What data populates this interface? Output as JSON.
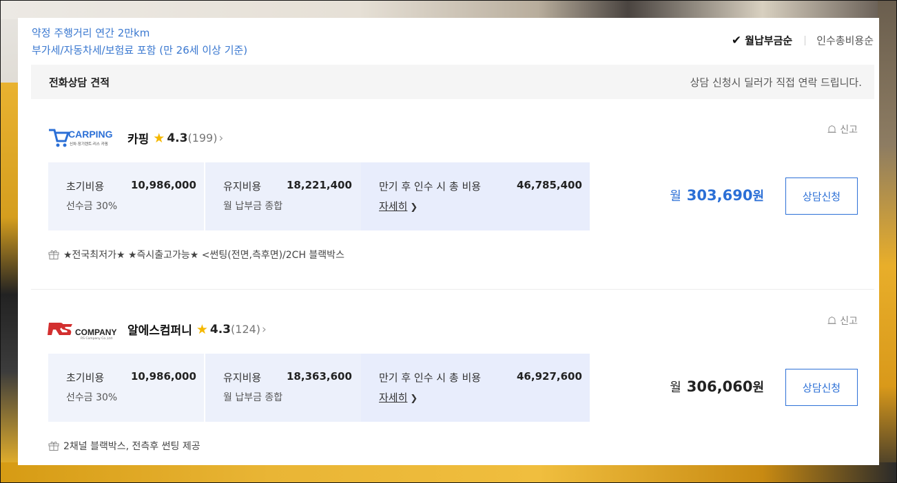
{
  "conditions": {
    "line1": "약정 주행거리 연간 2만km",
    "line2": "부가세/자동차세/보험료 포함 (만 26세 이상 기준)"
  },
  "sort": {
    "active_label": "월납부금순",
    "other_label": "인수총비용순"
  },
  "phone_section": {
    "title": "전화상담 견적",
    "note": "상담 신청시 딜러가 직접 연락 드립니다."
  },
  "offers": [
    {
      "logo_text": "CARPING",
      "logo_subtext": "신차·장기렌트·리스 카핑",
      "dealer_name": "카핑",
      "rating": "4.3",
      "review_count": "(199)",
      "report_label": "신고",
      "initial_cost_label": "초기비용",
      "initial_cost_value": "10,986,000",
      "initial_cost_sub": "선수금 30%",
      "maintenance_label": "유지비용",
      "maintenance_value": "18,221,400",
      "maintenance_sub": "월 납부금 종합",
      "total_label": "만기 후 인수 시 총 비용",
      "total_value": "46,785,400",
      "detail_link": "자세히",
      "monthly_prefix": "월",
      "monthly_amount": "303,690",
      "monthly_unit": "원",
      "monthly_color": "#2b6fd6",
      "button_label": "상담신청",
      "benefit": "★전국최저가★ ★즉시출고가능★ <썬팅(전면,측후면)/2CH 블랙박스"
    },
    {
      "logo_text": "COMPANY",
      "logo_subtext": "RS Company Co.,Ltd",
      "dealer_name": "알에스컴퍼니",
      "rating": "4.3",
      "review_count": "(124)",
      "report_label": "신고",
      "initial_cost_label": "초기비용",
      "initial_cost_value": "10,986,000",
      "initial_cost_sub": "선수금 30%",
      "maintenance_label": "유지비용",
      "maintenance_value": "18,363,600",
      "maintenance_sub": "월 납부금 종합",
      "total_label": "만기 후 인수 시 총 비용",
      "total_value": "46,927,600",
      "detail_link": "자세히",
      "monthly_prefix": "월",
      "monthly_amount": "306,060",
      "monthly_unit": "원",
      "monthly_color": "#222222",
      "button_label": "상담신청",
      "benefit": "2채널 블랙박스, 전측후 썬팅 제공"
    }
  ],
  "icons": {
    "sort_check": "check-icon",
    "star": "star-icon",
    "review_chevron": "chevron-right-icon",
    "report": "bell-icon",
    "detail_chevron": "chevron-right-icon",
    "benefit": "gift-icon"
  },
  "colors": {
    "accent": "#2b6fd6",
    "condition_text": "#3a78d0",
    "star": "#f5b800",
    "cost_bg": "#f0f3fb"
  }
}
